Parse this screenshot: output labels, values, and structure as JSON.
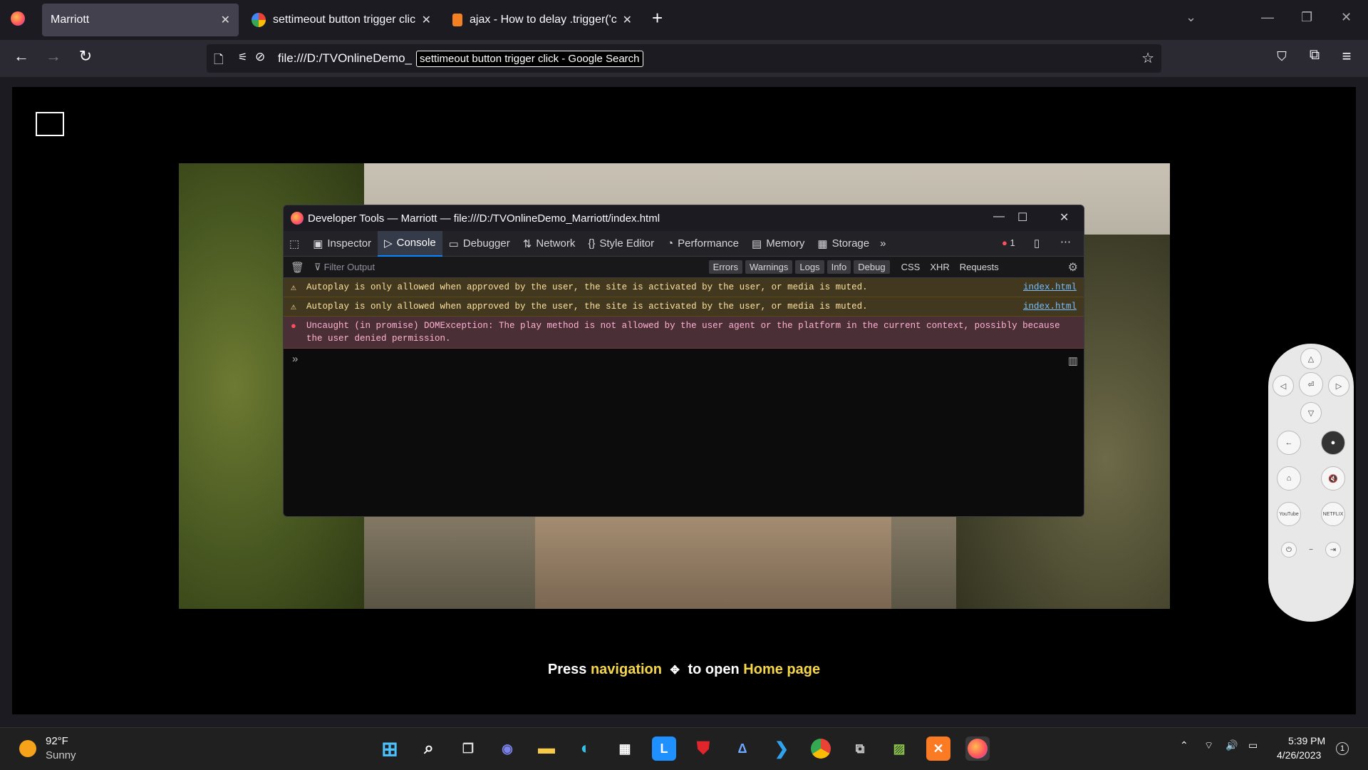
{
  "browser": {
    "tabs": [
      {
        "title": "Marriott",
        "active": true
      },
      {
        "title": "settimeout button trigger click",
        "active": false
      },
      {
        "title": "ajax - How to delay .trigger('cli",
        "active": false
      }
    ],
    "new_tab": "+",
    "url": "file:///D:/TVOnlineDemo_",
    "url_tooltip": "settimeout button trigger click - Google Search"
  },
  "devtools": {
    "title": "Developer Tools — Marriott — file:///D:/TVOnlineDemo_Marriott/index.html",
    "tabs": [
      "Inspector",
      "Console",
      "Debugger",
      "Network",
      "Style Editor",
      "Performance",
      "Memory",
      "Storage"
    ],
    "error_count": "1",
    "filter_placeholder": "Filter Output",
    "filters": [
      "Errors",
      "Warnings",
      "Logs",
      "Info",
      "Debug"
    ],
    "extra_filters": [
      "CSS",
      "XHR",
      "Requests"
    ],
    "messages": [
      {
        "type": "warning",
        "text": "Autoplay is only allowed when approved by the user, the site is activated by the user, or media is muted.",
        "source": "index.html"
      },
      {
        "type": "warning",
        "text": "Autoplay is only allowed when approved by the user, the site is activated by the user, or media is muted.",
        "source": "index.html"
      },
      {
        "type": "error",
        "text": "Uncaught (in promise) DOMException: The play method is not allowed by the user agent or the platform in the current context, possibly because the user denied permission.",
        "source": ""
      }
    ],
    "prompt": "»"
  },
  "page": {
    "caption_prefix": "Press",
    "caption_nav": "navigation",
    "caption_mid": "to open",
    "caption_home": "Home page"
  },
  "remote": {
    "youtube": "YouTube",
    "netflix": "NETFLIX"
  },
  "taskbar": {
    "temperature": "92°F",
    "weather": "Sunny",
    "time": "5:39 PM",
    "date": "4/26/2023",
    "notifications": "1"
  }
}
